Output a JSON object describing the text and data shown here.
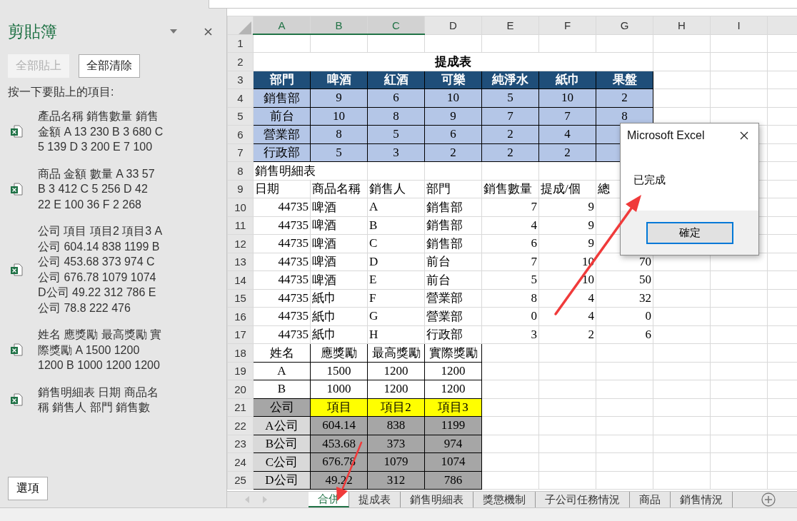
{
  "clipboard": {
    "title": "剪貼簿",
    "buttons": [
      {
        "label": "全部貼上",
        "disabled": true
      },
      {
        "label": "全部清除",
        "disabled": false
      }
    ],
    "instruction": "按一下要貼上的項目:",
    "items": [
      {
        "text": "產品名稱 銷售數量 銷售金額 A 13 230 B 3 680 C 5 139 D 3 200 E 7 100"
      },
      {
        "text": "商品 金額 數量 A 33 57 B 3 412 C 5 256 D 42 22 E 100 36 F 2 268"
      },
      {
        "text": "公司 項目 項目2 項目3 A公司 604.14 838 1199 B公司 453.68 373 974 C公司 676.78 1079 1074 D公司 49.22 312 786 E公司 78.8 222 476"
      },
      {
        "text": "姓名 應獎勵 最高獎勵 實際獎勵 A 1500 1200 1200 B 1000 1200 1200"
      },
      {
        "text": "銷售明細表 日期 商品名稱 銷售人 部門 銷售數"
      }
    ],
    "options_button": "選項"
  },
  "sheet": {
    "columns": [
      {
        "label": "A",
        "selected": true
      },
      {
        "label": "B",
        "selected": true
      },
      {
        "label": "C",
        "selected": true
      },
      {
        "label": "D",
        "selected": false
      },
      {
        "label": "E",
        "selected": false
      },
      {
        "label": "F",
        "selected": false
      },
      {
        "label": "G",
        "selected": false
      },
      {
        "label": "H",
        "selected": false
      },
      {
        "label": "I",
        "selected": false
      }
    ],
    "rows": [
      {
        "header": "1",
        "cells": []
      },
      {
        "header": "2",
        "cells": [
          {
            "text": "提成表",
            "kind": "title",
            "colspan": 7
          }
        ]
      },
      {
        "header": "3",
        "cells": [
          {
            "text": "部門",
            "kind": "th"
          },
          {
            "text": "啤酒",
            "kind": "th"
          },
          {
            "text": "紅酒",
            "kind": "th"
          },
          {
            "text": "可樂",
            "kind": "th"
          },
          {
            "text": "純淨水",
            "kind": "th"
          },
          {
            "text": "紙巾",
            "kind": "th"
          },
          {
            "text": "果盤",
            "kind": "th"
          }
        ]
      },
      {
        "header": "4",
        "cells": [
          {
            "text": "銷售部",
            "kind": "td"
          },
          {
            "text": "9",
            "kind": "td"
          },
          {
            "text": "6",
            "kind": "td"
          },
          {
            "text": "10",
            "kind": "td"
          },
          {
            "text": "5",
            "kind": "td"
          },
          {
            "text": "10",
            "kind": "td"
          },
          {
            "text": "2",
            "kind": "td"
          }
        ]
      },
      {
        "header": "5",
        "cells": [
          {
            "text": "前台",
            "kind": "td"
          },
          {
            "text": "10",
            "kind": "td"
          },
          {
            "text": "8",
            "kind": "td"
          },
          {
            "text": "9",
            "kind": "td"
          },
          {
            "text": "7",
            "kind": "td"
          },
          {
            "text": "7",
            "kind": "td"
          },
          {
            "text": "8",
            "kind": "td"
          }
        ]
      },
      {
        "header": "6",
        "cells": [
          {
            "text": "營業部",
            "kind": "td"
          },
          {
            "text": "8",
            "kind": "td"
          },
          {
            "text": "5",
            "kind": "td"
          },
          {
            "text": "6",
            "kind": "td"
          },
          {
            "text": "2",
            "kind": "td"
          },
          {
            "text": "4",
            "kind": "td"
          },
          {
            "kind": "td"
          }
        ]
      },
      {
        "header": "7",
        "cells": [
          {
            "text": "行政部",
            "kind": "td"
          },
          {
            "text": "5",
            "kind": "td"
          },
          {
            "text": "3",
            "kind": "td"
          },
          {
            "text": "2",
            "kind": "td"
          },
          {
            "text": "2",
            "kind": "td"
          },
          {
            "text": "2",
            "kind": "td"
          },
          {
            "kind": "td"
          }
        ]
      },
      {
        "header": "8",
        "cells": [
          {
            "text": "銷售明細表",
            "kind": "caption",
            "colspan": 2
          }
        ]
      },
      {
        "header": "9",
        "cells": [
          {
            "text": "日期",
            "kind": "label"
          },
          {
            "text": "商品名稱",
            "kind": "label"
          },
          {
            "text": "銷售人",
            "kind": "label"
          },
          {
            "text": "部門",
            "kind": "label"
          },
          {
            "text": "銷售數量",
            "kind": "label"
          },
          {
            "text": "提成/個",
            "kind": "label"
          },
          {
            "text": "總",
            "kind": "label"
          }
        ]
      },
      {
        "header": "10",
        "cells": [
          {
            "text": "44735",
            "kind": "num"
          },
          {
            "text": "啤酒",
            "kind": "label"
          },
          {
            "text": "A",
            "kind": "label"
          },
          {
            "text": "銷售部",
            "kind": "label"
          },
          {
            "text": "7",
            "kind": "num"
          },
          {
            "text": "9",
            "kind": "num"
          }
        ]
      },
      {
        "header": "11",
        "cells": [
          {
            "text": "44735",
            "kind": "num"
          },
          {
            "text": "啤酒",
            "kind": "label"
          },
          {
            "text": "B",
            "kind": "label"
          },
          {
            "text": "銷售部",
            "kind": "label"
          },
          {
            "text": "4",
            "kind": "num"
          },
          {
            "text": "9",
            "kind": "num"
          }
        ]
      },
      {
        "header": "12",
        "cells": [
          {
            "text": "44735",
            "kind": "num"
          },
          {
            "text": "啤酒",
            "kind": "label"
          },
          {
            "text": "C",
            "kind": "label"
          },
          {
            "text": "銷售部",
            "kind": "label"
          },
          {
            "text": "6",
            "kind": "num"
          },
          {
            "text": "9",
            "kind": "num"
          }
        ]
      },
      {
        "header": "13",
        "cells": [
          {
            "text": "44735",
            "kind": "num"
          },
          {
            "text": "啤酒",
            "kind": "label"
          },
          {
            "text": "D",
            "kind": "label"
          },
          {
            "text": "前台",
            "kind": "label"
          },
          {
            "text": "7",
            "kind": "num"
          },
          {
            "text": "10",
            "kind": "num"
          },
          {
            "text": "70",
            "kind": "num"
          }
        ]
      },
      {
        "header": "14",
        "cells": [
          {
            "text": "44735",
            "kind": "num"
          },
          {
            "text": "啤酒",
            "kind": "label"
          },
          {
            "text": "E",
            "kind": "label"
          },
          {
            "text": "前台",
            "kind": "label"
          },
          {
            "text": "5",
            "kind": "num"
          },
          {
            "text": "10",
            "kind": "num"
          },
          {
            "text": "50",
            "kind": "num"
          }
        ]
      },
      {
        "header": "15",
        "cells": [
          {
            "text": "44735",
            "kind": "num"
          },
          {
            "text": "紙巾",
            "kind": "label"
          },
          {
            "text": "F",
            "kind": "label"
          },
          {
            "text": "營業部",
            "kind": "label"
          },
          {
            "text": "8",
            "kind": "num"
          },
          {
            "text": "4",
            "kind": "num"
          },
          {
            "text": "32",
            "kind": "num"
          }
        ]
      },
      {
        "header": "16",
        "cells": [
          {
            "text": "44735",
            "kind": "num"
          },
          {
            "text": "紙巾",
            "kind": "label"
          },
          {
            "text": "G",
            "kind": "label"
          },
          {
            "text": "營業部",
            "kind": "label"
          },
          {
            "text": "0",
            "kind": "num"
          },
          {
            "text": "4",
            "kind": "num"
          },
          {
            "text": "0",
            "kind": "num"
          }
        ]
      },
      {
        "header": "17",
        "cells": [
          {
            "text": "44735",
            "kind": "num"
          },
          {
            "text": "紙巾",
            "kind": "label"
          },
          {
            "text": "H",
            "kind": "label"
          },
          {
            "text": "行政部",
            "kind": "label"
          },
          {
            "text": "3",
            "kind": "num"
          },
          {
            "text": "2",
            "kind": "num"
          },
          {
            "text": "6",
            "kind": "num"
          }
        ]
      },
      {
        "header": "18",
        "cells": [
          {
            "text": "姓名",
            "kind": "grid"
          },
          {
            "text": "應獎勵",
            "kind": "grid"
          },
          {
            "text": "最高獎勵",
            "kind": "grid"
          },
          {
            "text": "實際獎勵",
            "kind": "grid"
          }
        ]
      },
      {
        "header": "19",
        "cells": [
          {
            "text": "A",
            "kind": "grid"
          },
          {
            "text": "1500",
            "kind": "grid"
          },
          {
            "text": "1200",
            "kind": "grid"
          },
          {
            "text": "1200",
            "kind": "grid"
          }
        ]
      },
      {
        "header": "20",
        "cells": [
          {
            "text": "B",
            "kind": "grid"
          },
          {
            "text": "1000",
            "kind": "grid"
          },
          {
            "text": "1200",
            "kind": "grid"
          },
          {
            "text": "1200",
            "kind": "grid"
          }
        ]
      },
      {
        "header": "21",
        "cells": [
          {
            "text": "公司",
            "kind": "gray"
          },
          {
            "text": "項目",
            "kind": "yellow"
          },
          {
            "text": "項目2",
            "kind": "yellow"
          },
          {
            "text": "項目3",
            "kind": "yellow"
          }
        ]
      },
      {
        "header": "22",
        "cells": [
          {
            "text": "A公司",
            "kind": "light"
          },
          {
            "text": "604.14",
            "kind": "gray"
          },
          {
            "text": "838",
            "kind": "gray"
          },
          {
            "text": "1199",
            "kind": "gray"
          }
        ]
      },
      {
        "header": "23",
        "cells": [
          {
            "text": "B公司",
            "kind": "light"
          },
          {
            "text": "453.68",
            "kind": "gray"
          },
          {
            "text": "373",
            "kind": "gray"
          },
          {
            "text": "974",
            "kind": "gray"
          }
        ]
      },
      {
        "header": "24",
        "cells": [
          {
            "text": "C公司",
            "kind": "light"
          },
          {
            "text": "676.78",
            "kind": "gray"
          },
          {
            "text": "1079",
            "kind": "gray"
          },
          {
            "text": "1074",
            "kind": "gray"
          }
        ]
      },
      {
        "header": "25",
        "cells": [
          {
            "text": "D公司",
            "kind": "light"
          },
          {
            "text": "49.22",
            "kind": "gray"
          },
          {
            "text": "312",
            "kind": "gray"
          },
          {
            "text": "786",
            "kind": "gray"
          }
        ]
      }
    ]
  },
  "tabs": [
    {
      "label": "合併",
      "selected": true
    },
    {
      "label": "提成表",
      "selected": false
    },
    {
      "label": "銷售明細表",
      "selected": false
    },
    {
      "label": "獎懲機制",
      "selected": false
    },
    {
      "label": "子公司任務情況",
      "selected": false
    },
    {
      "label": "商品",
      "selected": false
    },
    {
      "label": "銷售情況",
      "selected": false
    }
  ],
  "dialog": {
    "title": "Microsoft Excel",
    "message": "已完成",
    "button": "確定"
  }
}
